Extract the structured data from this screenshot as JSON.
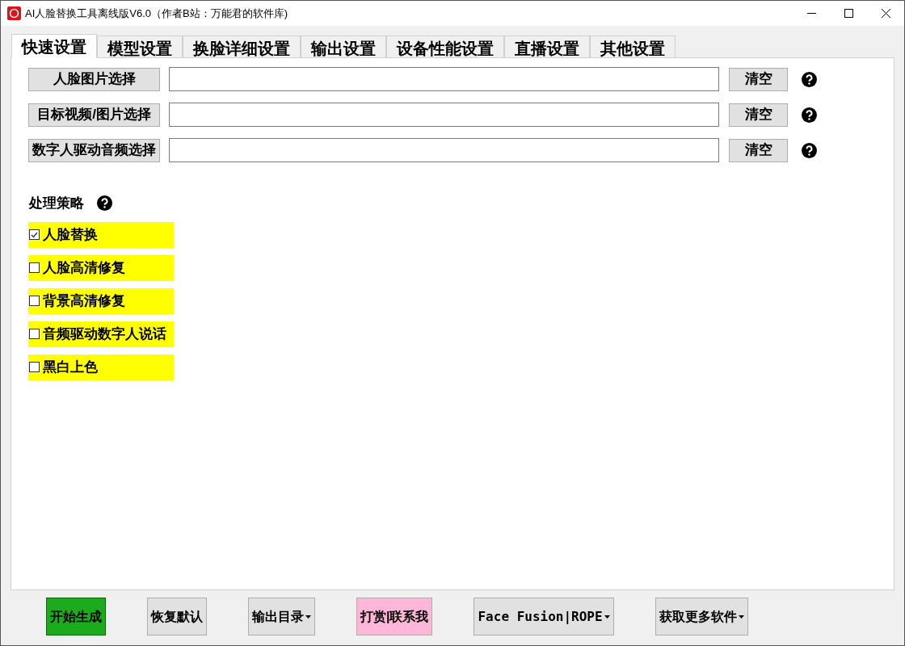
{
  "window": {
    "title": "AI人脸替换工具离线版V6.0（作者B站：万能君的软件库)"
  },
  "tabs": [
    {
      "label": "快速设置",
      "selected": true
    },
    {
      "label": "模型设置",
      "selected": false
    },
    {
      "label": "换脸详细设置",
      "selected": false
    },
    {
      "label": "输出设置",
      "selected": false
    },
    {
      "label": "设备性能设置",
      "selected": false
    },
    {
      "label": "直播设置",
      "selected": false
    },
    {
      "label": "其他设置",
      "selected": false
    }
  ],
  "file_rows": [
    {
      "button": "人脸图片选择",
      "clear": "清空"
    },
    {
      "button": "目标视频/图片选择",
      "clear": "清空"
    },
    {
      "button": "数字人驱动音频选择",
      "clear": "清空"
    }
  ],
  "strategy": {
    "label": "处理策略",
    "options": [
      {
        "label": "人脸替换",
        "checked": true
      },
      {
        "label": "人脸高清修复",
        "checked": false
      },
      {
        "label": "背景高清修复",
        "checked": false
      },
      {
        "label": "音频驱动数字人说话",
        "checked": false
      },
      {
        "label": "黑白上色",
        "checked": false
      }
    ]
  },
  "bottom_buttons": [
    {
      "label": "开始生成",
      "kind": "start",
      "dropdown": false
    },
    {
      "label": "恢复默认",
      "kind": "normal",
      "dropdown": false
    },
    {
      "label": "输出目录",
      "kind": "normal",
      "dropdown": true
    },
    {
      "label": "打赏|联系我",
      "kind": "donate",
      "dropdown": false
    },
    {
      "label": "Face Fusion|ROPE",
      "kind": "normal",
      "dropdown": true
    },
    {
      "label": "获取更多软件",
      "kind": "normal",
      "dropdown": true
    }
  ]
}
